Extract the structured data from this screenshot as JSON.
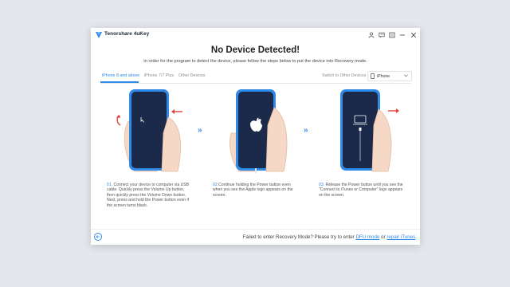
{
  "window": {
    "app_title": "Tenorshare 4uKey",
    "title_icons": [
      "user-icon",
      "feedback-icon",
      "menu-icon",
      "minimize-icon",
      "close-icon"
    ]
  },
  "main": {
    "heading": "No Device Detected!",
    "subheading": "In order for the program to detect the device, please follow the steps below to put the device into Recovery mode."
  },
  "tabs": [
    {
      "label": "iPhone 8 and above",
      "active": true
    },
    {
      "label": "iPhone 7/7 Plus",
      "active": false
    },
    {
      "label": "Other Devices",
      "active": false
    }
  ],
  "device_switch": {
    "label": "Switch to Other Devices",
    "selected": "iPhone"
  },
  "arrows": [
    "»",
    "»"
  ],
  "steps": [
    {
      "num": "01.",
      "text": "Connect your device to computer via USB cable. Quickly press the Volume Up button, then quickly press the Volume Down button. Next, press and hold the Power button even if the screen turns black."
    },
    {
      "num": "02.",
      "text": "Continue holding the Power button even when you see the Apple logo appears on the screen."
    },
    {
      "num": "03.",
      "text": "Release the Power button until you see the \"Connect to iTunes or Computer\" logo appears on the screen."
    }
  ],
  "footer": {
    "text": "Failed to enter Recovery Mode? Please try to enter",
    "link1": "DFU mode",
    "or": "or",
    "link2": "repair iTunes",
    "end": "."
  },
  "colors": {
    "accent": "#2f8ae8",
    "phone_frame": "#2f8ae8",
    "phone_screen": "#1b2a4a",
    "arrow_red": "#e2413a",
    "hand": "#f5d9c6"
  }
}
